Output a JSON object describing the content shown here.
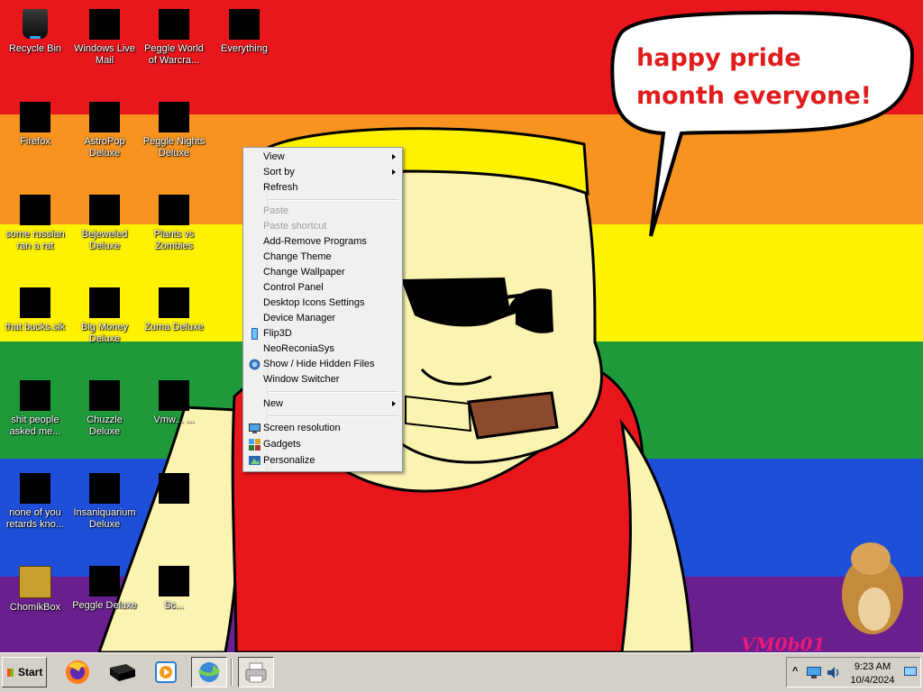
{
  "desktop": {
    "icons": [
      {
        "label": "Recycle Bin"
      },
      {
        "label": "Windows Live Mail"
      },
      {
        "label": "Peggle World of Warcra..."
      },
      {
        "label": "Everything"
      },
      {
        "label": "Firefox"
      },
      {
        "label": "AstroPop Deluxe"
      },
      {
        "label": "Peggle Nights Deluxe"
      },
      {
        "label": "some russian ran a rat"
      },
      {
        "label": "Bejeweled Deluxe"
      },
      {
        "label": "Plants vs Zombies"
      },
      {
        "label": "that bucks.sik"
      },
      {
        "label": "Big Money Deluxe"
      },
      {
        "label": "Zuma Deluxe"
      },
      {
        "label": "shit people asked me..."
      },
      {
        "label": "Chuzzle Deluxe"
      },
      {
        "label": "Vmw... ..."
      },
      {
        "label": "none of you retards kno..."
      },
      {
        "label": "Insaniquarium Deluxe"
      },
      {
        "label": ""
      },
      {
        "label": "ChomikBox"
      },
      {
        "label": "Peggle Deluxe"
      },
      {
        "label": "Sc..."
      }
    ]
  },
  "wallpaper": {
    "speech_bubble": "happy pride month everyone!",
    "signature": "VM0b01"
  },
  "context_menu": {
    "items": [
      {
        "label": "View",
        "submenu": true
      },
      {
        "label": "Sort by",
        "submenu": true
      },
      {
        "label": "Refresh"
      },
      {
        "label": "Paste",
        "disabled": true
      },
      {
        "label": "Paste shortcut",
        "disabled": true
      },
      {
        "label": "Add-Remove Programs"
      },
      {
        "label": "Change Theme"
      },
      {
        "label": "Change Wallpaper"
      },
      {
        "label": "Control Panel"
      },
      {
        "label": "Desktop Icons Settings"
      },
      {
        "label": "Device Manager"
      },
      {
        "label": "Flip3D",
        "icon": "flip3d-icon"
      },
      {
        "label": "NeoReconiaSys"
      },
      {
        "label": "Show / Hide Hidden Files",
        "icon": "hidden-files-icon"
      },
      {
        "label": "Window Switcher"
      },
      {
        "label": "New",
        "submenu": true
      },
      {
        "label": "Screen resolution",
        "icon": "display-icon"
      },
      {
        "label": "Gadgets",
        "icon": "gadgets-icon"
      },
      {
        "label": "Personalize",
        "icon": "personalize-icon"
      }
    ]
  },
  "taskbar": {
    "start_label": "Start",
    "pinned": [
      "firefox-icon",
      "terminal-icon",
      "media-player-icon",
      "internet-download-manager-icon",
      "printer-icon"
    ],
    "tray": {
      "time": "9:23 AM",
      "date": "10/4/2024"
    }
  },
  "colors": {
    "stripe_red": "#e9161c",
    "stripe_orange": "#f7931e",
    "stripe_yellow": "#fff200",
    "stripe_green": "#1e9a3a",
    "stripe_blue": "#1e4fd8",
    "stripe_purple": "#6a1f8f",
    "bubble_text": "#e11c1c"
  }
}
